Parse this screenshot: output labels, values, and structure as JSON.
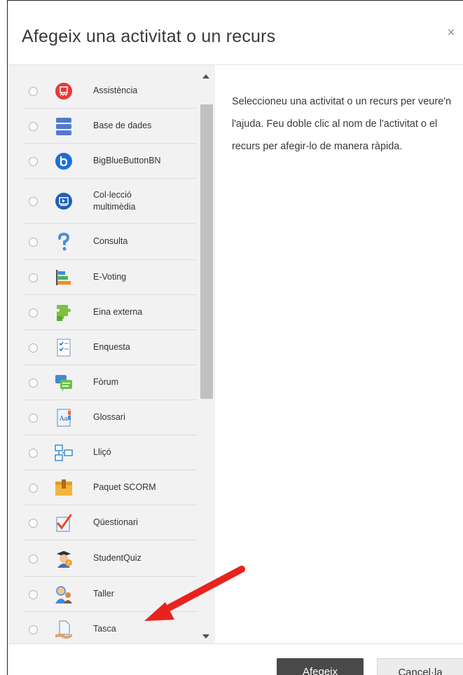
{
  "dialog": {
    "title": "Afegeix una activitat o un recurs",
    "close_symbol": "×"
  },
  "options": [
    {
      "label": "Assistència",
      "icon": "attendance-icon"
    },
    {
      "label": "Base de dades",
      "icon": "database-icon"
    },
    {
      "label": "BigBlueButtonBN",
      "icon": "bigbluebutton-icon"
    },
    {
      "label": "Col·lecció multimèdia",
      "icon": "media-collection-icon"
    },
    {
      "label": "Consulta",
      "icon": "question-icon"
    },
    {
      "label": "E-Voting",
      "icon": "evoting-icon"
    },
    {
      "label": "Eina externa",
      "icon": "puzzle-icon"
    },
    {
      "label": "Enquesta",
      "icon": "survey-icon"
    },
    {
      "label": "Fòrum",
      "icon": "forum-icon"
    },
    {
      "label": "Glossari",
      "icon": "glossary-icon"
    },
    {
      "label": "Lliçó",
      "icon": "lesson-icon"
    },
    {
      "label": "Paquet SCORM",
      "icon": "scorm-package-icon"
    },
    {
      "label": "Qüestionari",
      "icon": "quiz-icon"
    },
    {
      "label": "StudentQuiz",
      "icon": "studentquiz-icon"
    },
    {
      "label": "Taller",
      "icon": "workshop-icon"
    },
    {
      "label": "Tasca",
      "icon": "assignment-icon"
    }
  ],
  "help": {
    "text": "Seleccioneu una activitat o un recurs per veure'n l'ajuda. Feu doble clic al nom de l'activitat o el recurs per afegir-lo de manera ràpida."
  },
  "footer": {
    "add_label": "Afegeix",
    "cancel_label": "Cancel·la"
  },
  "colors": {
    "accent_arrow": "#e8231e",
    "add_button": "#4a4a4a"
  }
}
